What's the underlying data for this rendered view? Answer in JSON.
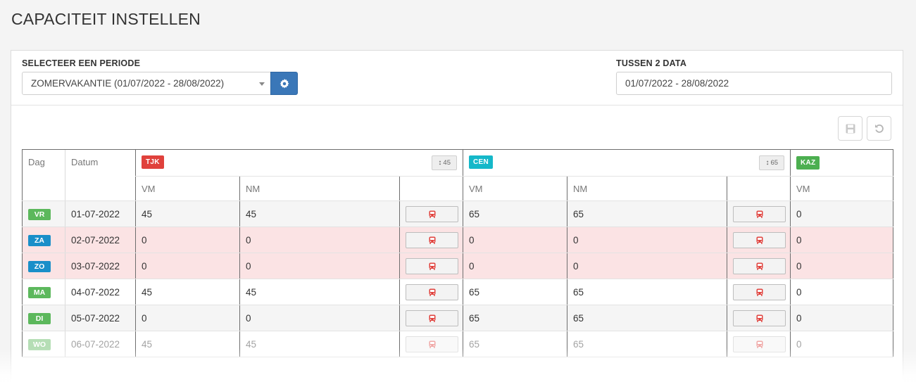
{
  "page": {
    "title": "CAPACITEIT INSTELLEN"
  },
  "filters": {
    "period_label": "SELECTEER EEN PERIODE",
    "period_value": "ZOMERVAKANTIE (01/07/2022 - 28/08/2022)",
    "range_label": "TUSSEN 2 DATA",
    "range_value": "01/07/2022 - 28/08/2022"
  },
  "table": {
    "col_day": "Dag",
    "col_date": "Datum",
    "sub_vm": "VM",
    "sub_nm": "NM",
    "sites": [
      {
        "code": "TJK",
        "color": "#e0413c",
        "capacity_arrow": "↕",
        "capacity": "45"
      },
      {
        "code": "CEN",
        "color": "#15b8c9",
        "capacity_arrow": "↕",
        "capacity": "65"
      },
      {
        "code": "KAZ",
        "color": "#4caf50"
      }
    ],
    "rows": [
      {
        "day": "VR",
        "day_color": "#5cb85c",
        "date": "01-07-2022",
        "tjk_vm": "45",
        "tjk_nm": "45",
        "cen_vm": "65",
        "cen_nm": "65",
        "kaz_vm": "0"
      },
      {
        "day": "ZA",
        "day_color": "#1a8fc9",
        "date": "02-07-2022",
        "tjk_vm": "0",
        "tjk_nm": "0",
        "cen_vm": "0",
        "cen_nm": "0",
        "kaz_vm": "0"
      },
      {
        "day": "ZO",
        "day_color": "#1a8fc9",
        "date": "03-07-2022",
        "tjk_vm": "0",
        "tjk_nm": "0",
        "cen_vm": "0",
        "cen_nm": "0",
        "kaz_vm": "0"
      },
      {
        "day": "MA",
        "day_color": "#5cb85c",
        "date": "04-07-2022",
        "tjk_vm": "45",
        "tjk_nm": "45",
        "cen_vm": "65",
        "cen_nm": "65",
        "kaz_vm": "0"
      },
      {
        "day": "DI",
        "day_color": "#5cb85c",
        "date": "05-07-2022",
        "tjk_vm": "0",
        "tjk_nm": "0",
        "cen_vm": "65",
        "cen_nm": "65",
        "kaz_vm": "0"
      },
      {
        "day": "WO",
        "day_color": "#5cb85c",
        "date": "06-07-2022",
        "tjk_vm": "45",
        "tjk_nm": "45",
        "cen_vm": "65",
        "cen_nm": "65",
        "kaz_vm": "0"
      }
    ]
  },
  "icons": {
    "gear": "gear-icon",
    "save": "save-icon",
    "undo": "undo-icon",
    "bus": "bus-icon",
    "bus_color": "#e0413c"
  }
}
